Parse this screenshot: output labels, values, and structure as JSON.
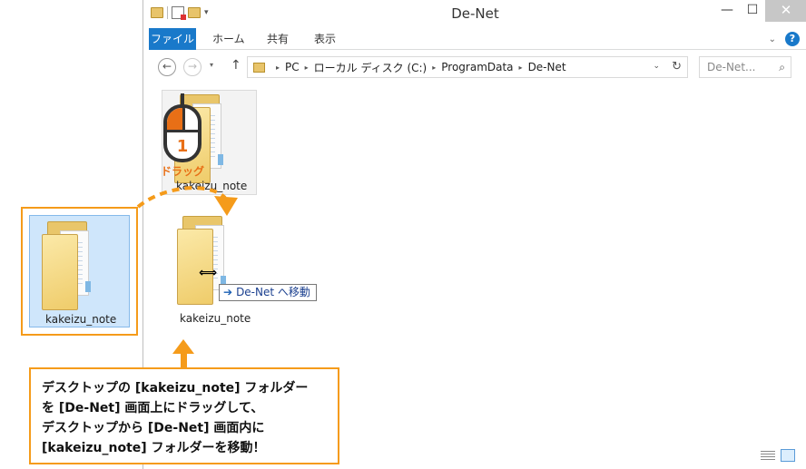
{
  "window": {
    "title": "De-Net",
    "min_glyph": "—",
    "max_glyph": "☐",
    "close_glyph": "✕"
  },
  "qat": {
    "dropdown_glyph": "▾"
  },
  "ribbon": {
    "tabs": [
      "ファイル",
      "ホーム",
      "共有",
      "表示"
    ],
    "expand_glyph": "⌄",
    "help_glyph": "?"
  },
  "navigation": {
    "back_glyph": "←",
    "forward_glyph": "→",
    "recent_glyph": "▾",
    "up_glyph": "↑",
    "breadcrumb": [
      "PC",
      "ローカル ディスク (C:)",
      "ProgramData",
      "De-Net"
    ],
    "crumb_separator": "▸",
    "address_dropdown_glyph": "⌄",
    "refresh_glyph": "↻",
    "search_placeholder": "De-Net...",
    "search_glyph": "⌕"
  },
  "items": {
    "existing_folder": "kakeizu_note",
    "moved_folder": "kakeizu_note",
    "desktop_folder": "kakeizu_note"
  },
  "annotation": {
    "mouse_number": "1",
    "drag_label": "ドラッグ",
    "drop_tooltip": "De-Net へ移動",
    "drop_arrow": "➔",
    "cursor_glyph": "⟺",
    "callout_lines": [
      "デスクトップの [kakeizu_note] フォルダー",
      "を [De-Net] 画面上にドラッグして、",
      "デスクトップから [De-Net] 画面内に",
      "[kakeizu_note] フォルダーを移動！"
    ]
  },
  "colors": {
    "accent_orange": "#f59b1a",
    "ribbon_blue": "#1979ca",
    "selection_blue": "#cfe6fb"
  }
}
